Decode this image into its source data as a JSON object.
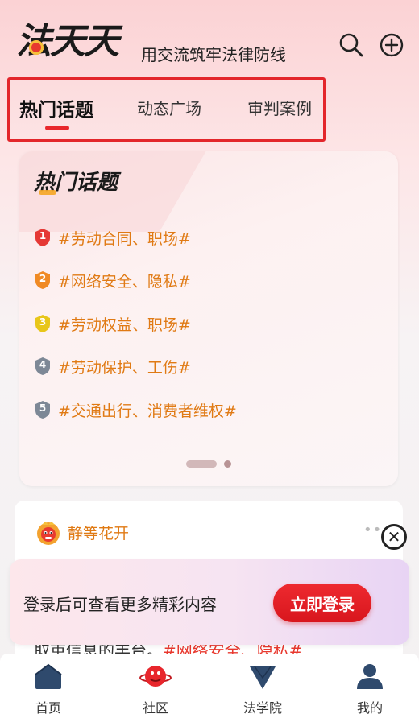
{
  "header": {
    "logo_text": "法天天",
    "slogan": "用交流筑牢法律防线"
  },
  "tabs": [
    {
      "label": "热门话题",
      "active": true
    },
    {
      "label": "动态广场",
      "active": false
    },
    {
      "label": "审判案例",
      "active": false
    }
  ],
  "hot_topics": {
    "title": "热门话题",
    "items": [
      {
        "rank": "1",
        "text": "#劳动合同、职场#",
        "badge_color": "#e53935"
      },
      {
        "rank": "2",
        "text": "#网络安全、隐私#",
        "badge_color": "#f08a24"
      },
      {
        "rank": "3",
        "text": "#劳动权益、职场#",
        "badge_color": "#e8c619"
      },
      {
        "rank": "4",
        "text": "#劳动保护、工伤#",
        "badge_color": "#7d8896"
      },
      {
        "rank": "5",
        "text": "#交通出行、消费者维权#",
        "badge_color": "#7d8896"
      }
    ]
  },
  "post": {
    "author": "静等花开",
    "more": "•••",
    "snippet_prefix": "取重信息的丰台。",
    "snippet_tag": "#网络安全、隐私#"
  },
  "login_banner": {
    "text": "登录后可查看更多精彩内容",
    "button_label": "立即登录"
  },
  "bottom_nav": [
    {
      "label": "首页",
      "icon": "home-icon"
    },
    {
      "label": "社区",
      "icon": "community-icon"
    },
    {
      "label": "法学院",
      "icon": "law-school-icon"
    },
    {
      "label": "我的",
      "icon": "profile-icon"
    }
  ],
  "colors": {
    "accent": "#e8272c",
    "topic_text": "#e07a14"
  }
}
